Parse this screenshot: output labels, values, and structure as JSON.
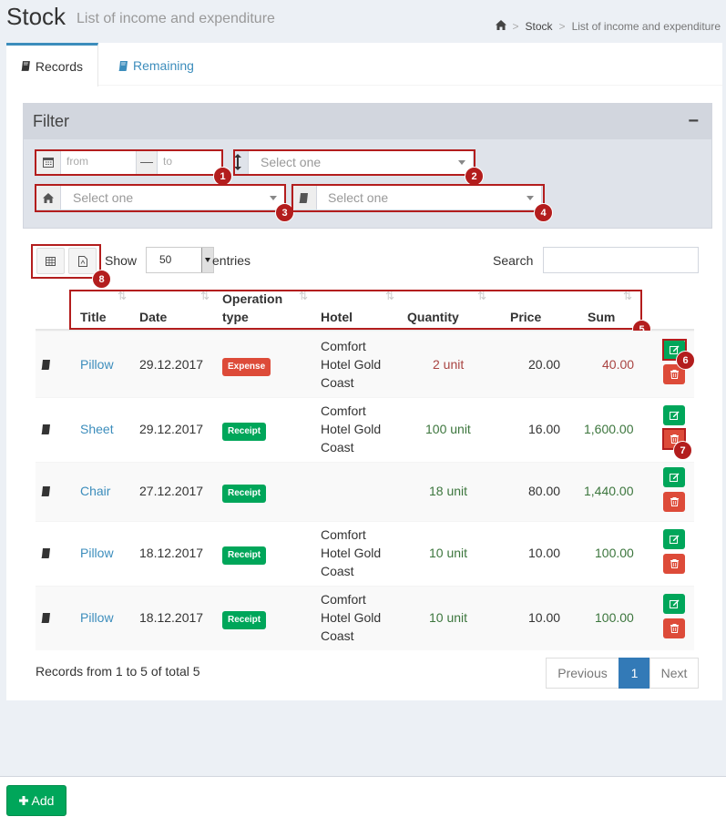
{
  "header": {
    "title": "Stock",
    "subtitle": "List of income and expenditure",
    "breadcrumb": [
      "Stock",
      "List of income and expenditure"
    ]
  },
  "tabs": [
    {
      "label": "Records",
      "active": true,
      "icon": "book-icon"
    },
    {
      "label": "Remaining",
      "active": false,
      "icon": "book-icon"
    }
  ],
  "filter": {
    "title": "Filter",
    "collapse_symbol": "−",
    "date_from_placeholder": "from",
    "date_separator": "—",
    "date_to_placeholder": "to",
    "operation_select": "Select one",
    "hotel_select": "Select one",
    "item_select": "Select one"
  },
  "table_controls": {
    "show_label": "Show",
    "entries_value": "50",
    "entries_label": "entries",
    "search_label": "Search"
  },
  "columns": [
    "Title",
    "Date",
    "Operation type",
    "Hotel",
    "Quantity",
    "Price",
    "Sum"
  ],
  "rows": [
    {
      "title": "Pillow",
      "date": "29.12.2017",
      "type": "Expense",
      "hotel": [
        "Comfort",
        "Hotel Gold",
        "Coast"
      ],
      "quantity": "2 unit",
      "price": "20.00",
      "sum": "40.00"
    },
    {
      "title": "Sheet",
      "date": "29.12.2017",
      "type": "Receipt",
      "hotel": [
        "Comfort",
        "Hotel Gold",
        "Coast"
      ],
      "quantity": "100 unit",
      "price": "16.00",
      "sum": "1,600.00"
    },
    {
      "title": "Chair",
      "date": "27.12.2017",
      "type": "Receipt",
      "hotel": [
        "",
        "",
        ""
      ],
      "quantity": "18 unit",
      "price": "80.00",
      "sum": "1,440.00"
    },
    {
      "title": "Pillow",
      "date": "18.12.2017",
      "type": "Receipt",
      "hotel": [
        "Comfort",
        "Hotel Gold",
        "Coast"
      ],
      "quantity": "10 unit",
      "price": "10.00",
      "sum": "100.00"
    },
    {
      "title": "Pillow",
      "date": "18.12.2017",
      "type": "Receipt",
      "hotel": [
        "Comfort",
        "Hotel Gold",
        "Coast"
      ],
      "quantity": "10 unit",
      "price": "10.00",
      "sum": "100.00"
    }
  ],
  "footer_info": "Records from 1 to 5 of total 5",
  "pagination": {
    "previous": "Previous",
    "current": "1",
    "next": "Next"
  },
  "add_button": "Add",
  "annotations": [
    "1",
    "2",
    "3",
    "4",
    "5",
    "6",
    "7",
    "8"
  ],
  "colors": {
    "accent": "#3c8dbc",
    "success": "#00a65a",
    "danger": "#dd4b39",
    "annotation": "#b31d1d"
  }
}
